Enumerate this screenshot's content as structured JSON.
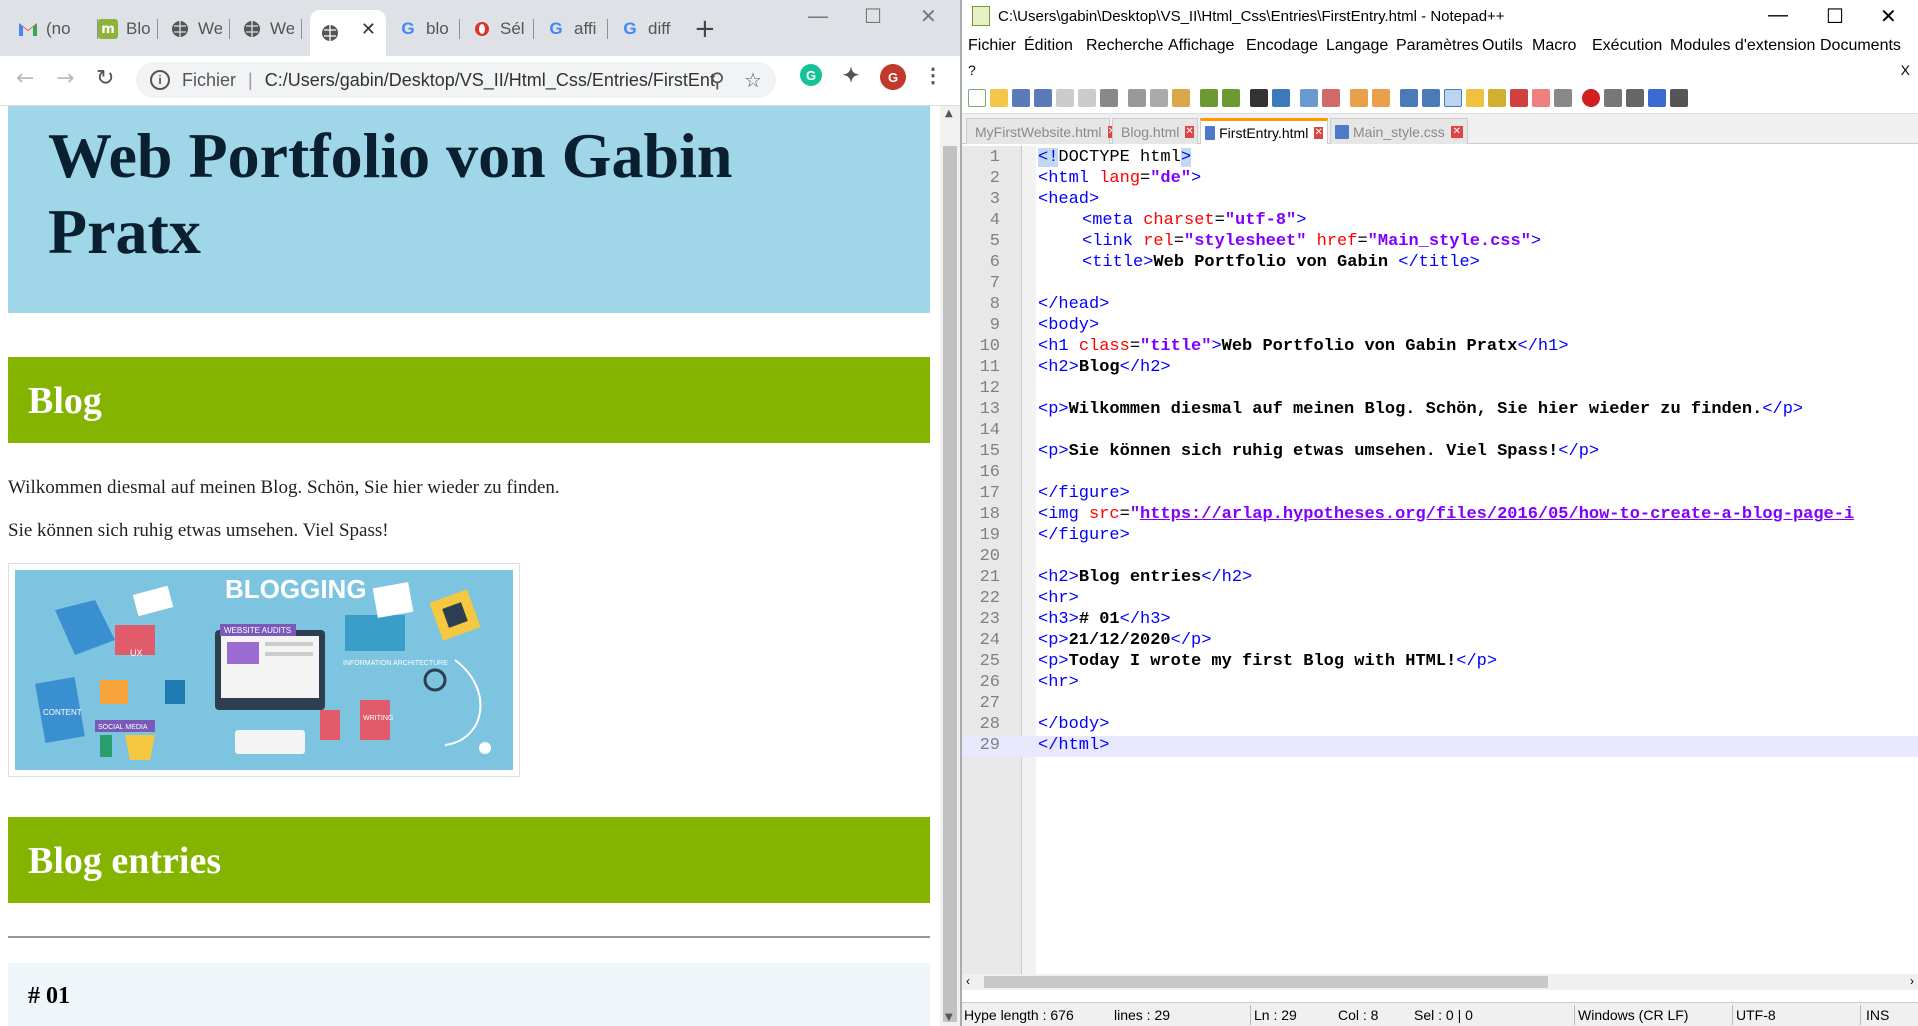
{
  "browser": {
    "tabs": [
      {
        "title": "(no",
        "icon": "gmail-icon"
      },
      {
        "title": "Blo",
        "icon": "m-icon"
      },
      {
        "title": "We",
        "icon": "globe-icon"
      },
      {
        "title": "We",
        "icon": "globe-icon"
      },
      {
        "title": "",
        "icon": "globe-icon",
        "active": true
      },
      {
        "title": "blo",
        "icon": "google-icon"
      },
      {
        "title": "Sél",
        "icon": "opera-icon"
      },
      {
        "title": "affi",
        "icon": "google-icon"
      },
      {
        "title": "diff",
        "icon": "google-icon"
      }
    ],
    "new_tab": "+",
    "url_label": "Fichier",
    "url": "C:/Users/gabin/Desktop/VS_II/Html_Css/Entries/FirstEnt...",
    "profile_initial": "G",
    "page": {
      "h1": "Web Portfolio von Gabin Pratx",
      "h2_blog": "Blog",
      "p1": "Wilkommen diesmal auf meinen Blog. Schön, Sie hier wieder zu finden.",
      "p2": "Sie können sich ruhig etwas umsehen. Viel Spass!",
      "image_title": "BLOGGING",
      "image_labels": {
        "ux": "UX",
        "audits": "WEBSITE AUDITS",
        "info": "INFORMATION ARCHITECTURE",
        "content": "CONTENT",
        "social": "SOCIAL MEDIA",
        "writing": "WRITING"
      },
      "h2_entries": "Blog entries",
      "h3": "# 01"
    }
  },
  "notepad": {
    "title": "C:\\Users\\gabin\\Desktop\\VS_II\\Html_Css\\Entries\\FirstEntry.html - Notepad++",
    "menu": [
      "Fichier",
      "Édition",
      "Recherche",
      "Affichage",
      "Encodage",
      "Langage",
      "Paramètres",
      "Outils",
      "Macro",
      "Exécution",
      "Modules d'extension",
      "Documents"
    ],
    "menu_help": "?",
    "menu_close": "X",
    "file_tabs": [
      "MyFirstWebsite.html",
      "Blog.html",
      "FirstEntry.html",
      "Main_style.css"
    ],
    "lines": [
      "1",
      "2",
      "3",
      "4",
      "5",
      "6",
      "7",
      "8",
      "9",
      "10",
      "11",
      "12",
      "13",
      "14",
      "15",
      "16",
      "17",
      "18",
      "19",
      "20",
      "21",
      "22",
      "23",
      "24",
      "25",
      "26",
      "27",
      "28",
      "29"
    ],
    "code": {
      "l1": {
        "tag_open": "<!",
        "doctype": "DOCTYPE html",
        "tag_close": ">"
      },
      "l2": {
        "tag": "<html ",
        "attr": "lang",
        "eq": "=",
        "val": "\"de\"",
        "close": ">"
      },
      "l3": "<head>",
      "l4": {
        "tag": "<meta ",
        "attr": "charset",
        "eq": "=",
        "val": "\"utf-8\"",
        "close": ">"
      },
      "l5": {
        "tag": "<link ",
        "attr1": "rel",
        "eq1": "=",
        "val1": "\"stylesheet\"",
        "attr2": " href",
        "eq2": "=",
        "val2": "\"Main_style.css\"",
        "close": ">"
      },
      "l6": {
        "open": "<title>",
        "text": "Web Portfolio von Gabin ",
        "close": "</title>"
      },
      "l8": "</head>",
      "l9": "<body>",
      "l10": {
        "tag": "<h1 ",
        "attr": "class",
        "eq": "=",
        "val": "\"title\"",
        "gt": ">",
        "text": "Web Portfolio von Gabin Pratx",
        "close": "</h1>"
      },
      "l11": {
        "open": "<h2>",
        "text": "Blog",
        "close": "</h2>"
      },
      "l13": {
        "open": "<p>",
        "text": "Wilkommen diesmal auf meinen Blog. Schön, Sie hier wieder zu finden.",
        "close": "</p>"
      },
      "l15": {
        "open": "<p>",
        "text": "Sie können sich ruhig etwas umsehen. Viel Spass!",
        "close": "</p>"
      },
      "l17": "</figure>",
      "l18": {
        "tag": "<img ",
        "attr": "src",
        "eq": "=",
        "q": "\"",
        "val": "https://arlap.hypotheses.org/files/2016/05/how-to-create-a-blog-page-i"
      },
      "l19": "</figure>",
      "l21": {
        "open": "<h2>",
        "text": "Blog entries",
        "close": "</h2>"
      },
      "l22": "<hr>",
      "l23": {
        "open": "<h3>",
        "text": "# 01",
        "close": "</h3>"
      },
      "l24": {
        "open": "<p>",
        "text": "21/12/2020",
        "close": "</p>"
      },
      "l25": {
        "open": "<p>",
        "text": "Today I wrote my first Blog with HTML!",
        "close": "</p>"
      },
      "l26": "<hr>",
      "l28": "</body>",
      "l29": "</html>"
    },
    "status": {
      "length": "Hype length : 676",
      "lines": "lines : 29",
      "ln": "Ln : 29",
      "col": "Col : 8",
      "sel": "Sel : 0 | 0",
      "eol": "Windows (CR LF)",
      "enc": "UTF-8",
      "mode": "INS"
    }
  }
}
